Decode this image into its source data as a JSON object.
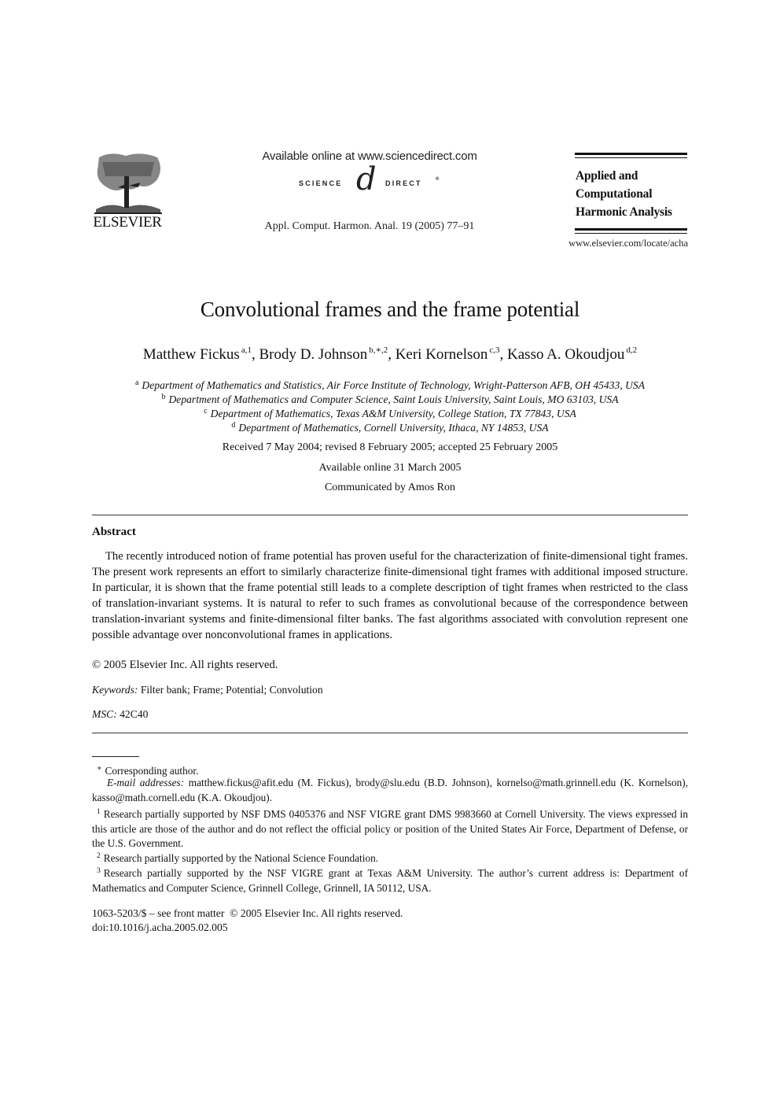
{
  "header": {
    "publisher_logo": {
      "icon": "elsevier-tree-icon",
      "wordmark": "ELSEVIER"
    },
    "available_online": "Available online at www.sciencedirect.com",
    "sciencedirect_logo": {
      "left": "SCIENCE",
      "symbol": "d",
      "right": "DIRECT",
      "mark": "®"
    },
    "citation": "Appl. Comput. Harmon. Anal. 19 (2005) 77–91",
    "journal_title_lines": [
      "Applied and",
      "Computational",
      "Harmonic Analysis"
    ],
    "journal_url": "www.elsevier.com/locate/acha"
  },
  "article": {
    "title": "Convolutional frames and the frame potential",
    "authors": [
      {
        "name": "Matthew Fickus",
        "sup": "a,1",
        "sep": ", "
      },
      {
        "name": "Brody D. Johnson",
        "sup": "b,∗,2",
        "sep": ", "
      },
      {
        "name": "Keri Kornelson",
        "sup": "c,3",
        "sep": ", "
      },
      {
        "name": "Kasso A. Okoudjou",
        "sup": "d,2",
        "sep": ""
      }
    ],
    "affiliations": [
      {
        "key": "a",
        "text": "Department of Mathematics and Statistics, Air Force Institute of Technology, Wright-Patterson AFB, OH 45433, USA"
      },
      {
        "key": "b",
        "text": "Department of Mathematics and Computer Science, Saint Louis University, Saint Louis, MO 63103, USA"
      },
      {
        "key": "c",
        "text": "Department of Mathematics, Texas A&M University, College Station, TX 77843, USA"
      },
      {
        "key": "d",
        "text": "Department of Mathematics, Cornell University, Ithaca, NY 14853, USA"
      }
    ],
    "received": "Received 7 May 2004; revised 8 February 2005; accepted 25 February 2005",
    "available": "Available online 31 March 2005",
    "communicated": "Communicated by Amos Ron"
  },
  "abstract": {
    "heading": "Abstract",
    "body": "The recently introduced notion of frame potential has proven useful for the characterization of finite-dimensional tight frames. The present work represents an effort to similarly characterize finite-dimensional tight frames with additional imposed structure. In particular, it is shown that the frame potential still leads to a complete description of tight frames when restricted to the class of translation-invariant systems. It is natural to refer to such frames as convolutional because of the correspondence between translation-invariant systems and finite-dimensional filter banks. The fast algorithms associated with convolution represent one possible advantage over nonconvolutional frames in applications.",
    "copyright": "© 2005 Elsevier Inc. All rights reserved.",
    "keywords_label": "Keywords:",
    "keywords": "Filter bank; Frame; Potential; Convolution",
    "msc_label": "MSC:",
    "msc": "42C40"
  },
  "footnotes": {
    "corresponding": {
      "mark": "∗",
      "text": "Corresponding author."
    },
    "emails_label": "E-mail addresses:",
    "emails": "matthew.fickus@afit.edu (M. Fickus), brody@slu.edu (B.D. Johnson), kornelso@math.grinnell.edu (K. Kornelson), kasso@math.cornell.edu (K.A. Okoudjou).",
    "notes": [
      {
        "mark": "1",
        "text": "Research partially supported by NSF DMS 0405376 and NSF VIGRE grant DMS 9983660 at Cornell University. The views expressed in this article are those of the author and do not reflect the official policy or position of the United States Air Force, Department of Defense, or the U.S. Government."
      },
      {
        "mark": "2",
        "text": "Research partially supported by the National Science Foundation."
      },
      {
        "mark": "3",
        "text": "Research partially supported by the NSF VIGRE grant at Texas A&M University. The author’s current address is: Department of Mathematics and Computer Science, Grinnell College, Grinnell, IA 50112, USA."
      }
    ]
  },
  "issn_line": "1063-5203/$ – see front matter  © 2005 Elsevier Inc. All rights reserved.",
  "doi": "doi:10.1016/j.acha.2005.02.005"
}
